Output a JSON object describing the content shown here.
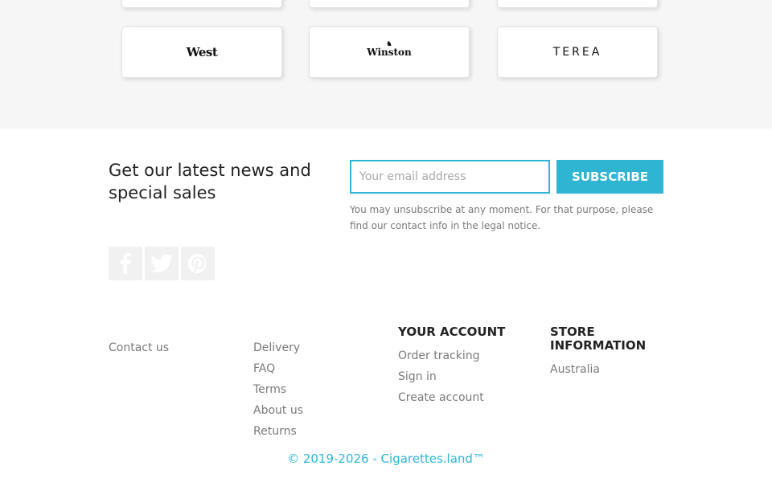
{
  "brands": {
    "row1": [
      "",
      "",
      ""
    ],
    "row2": [
      {
        "name": "West",
        "icon": "west-logo"
      },
      {
        "name": "Winston",
        "icon": "winston-logo"
      },
      {
        "name": "TEREA",
        "icon": "terea-logo"
      }
    ]
  },
  "newsletter": {
    "title": "Get our latest news and special sales",
    "email_placeholder": "Your email address",
    "subscribe_label": "Subscribe",
    "legal_text": "You may unsubscribe at any moment. For that purpose, please find our contact info in the legal notice."
  },
  "social": [
    {
      "name": "Facebook",
      "icon": "facebook-icon"
    },
    {
      "name": "Twitter",
      "icon": "twitter-icon"
    },
    {
      "name": "Pinterest",
      "icon": "pinterest-icon"
    }
  ],
  "footer": {
    "col1": {
      "links": [
        "Contact us"
      ]
    },
    "col2": {
      "links": [
        "Delivery",
        "FAQ",
        "Terms",
        "About us",
        "Returns"
      ]
    },
    "col3": {
      "title": "Your account",
      "links": [
        "Order tracking",
        "Sign in",
        "Create account"
      ]
    },
    "col4": {
      "title": "Store information",
      "links": [
        "Australia"
      ]
    }
  },
  "copyright": "© 2019-2026 - Cigarettes.land™",
  "colors": {
    "accent": "#2fb5d2",
    "muted_text": "#7a7a7a",
    "band_bg": "#f6f6f6"
  }
}
